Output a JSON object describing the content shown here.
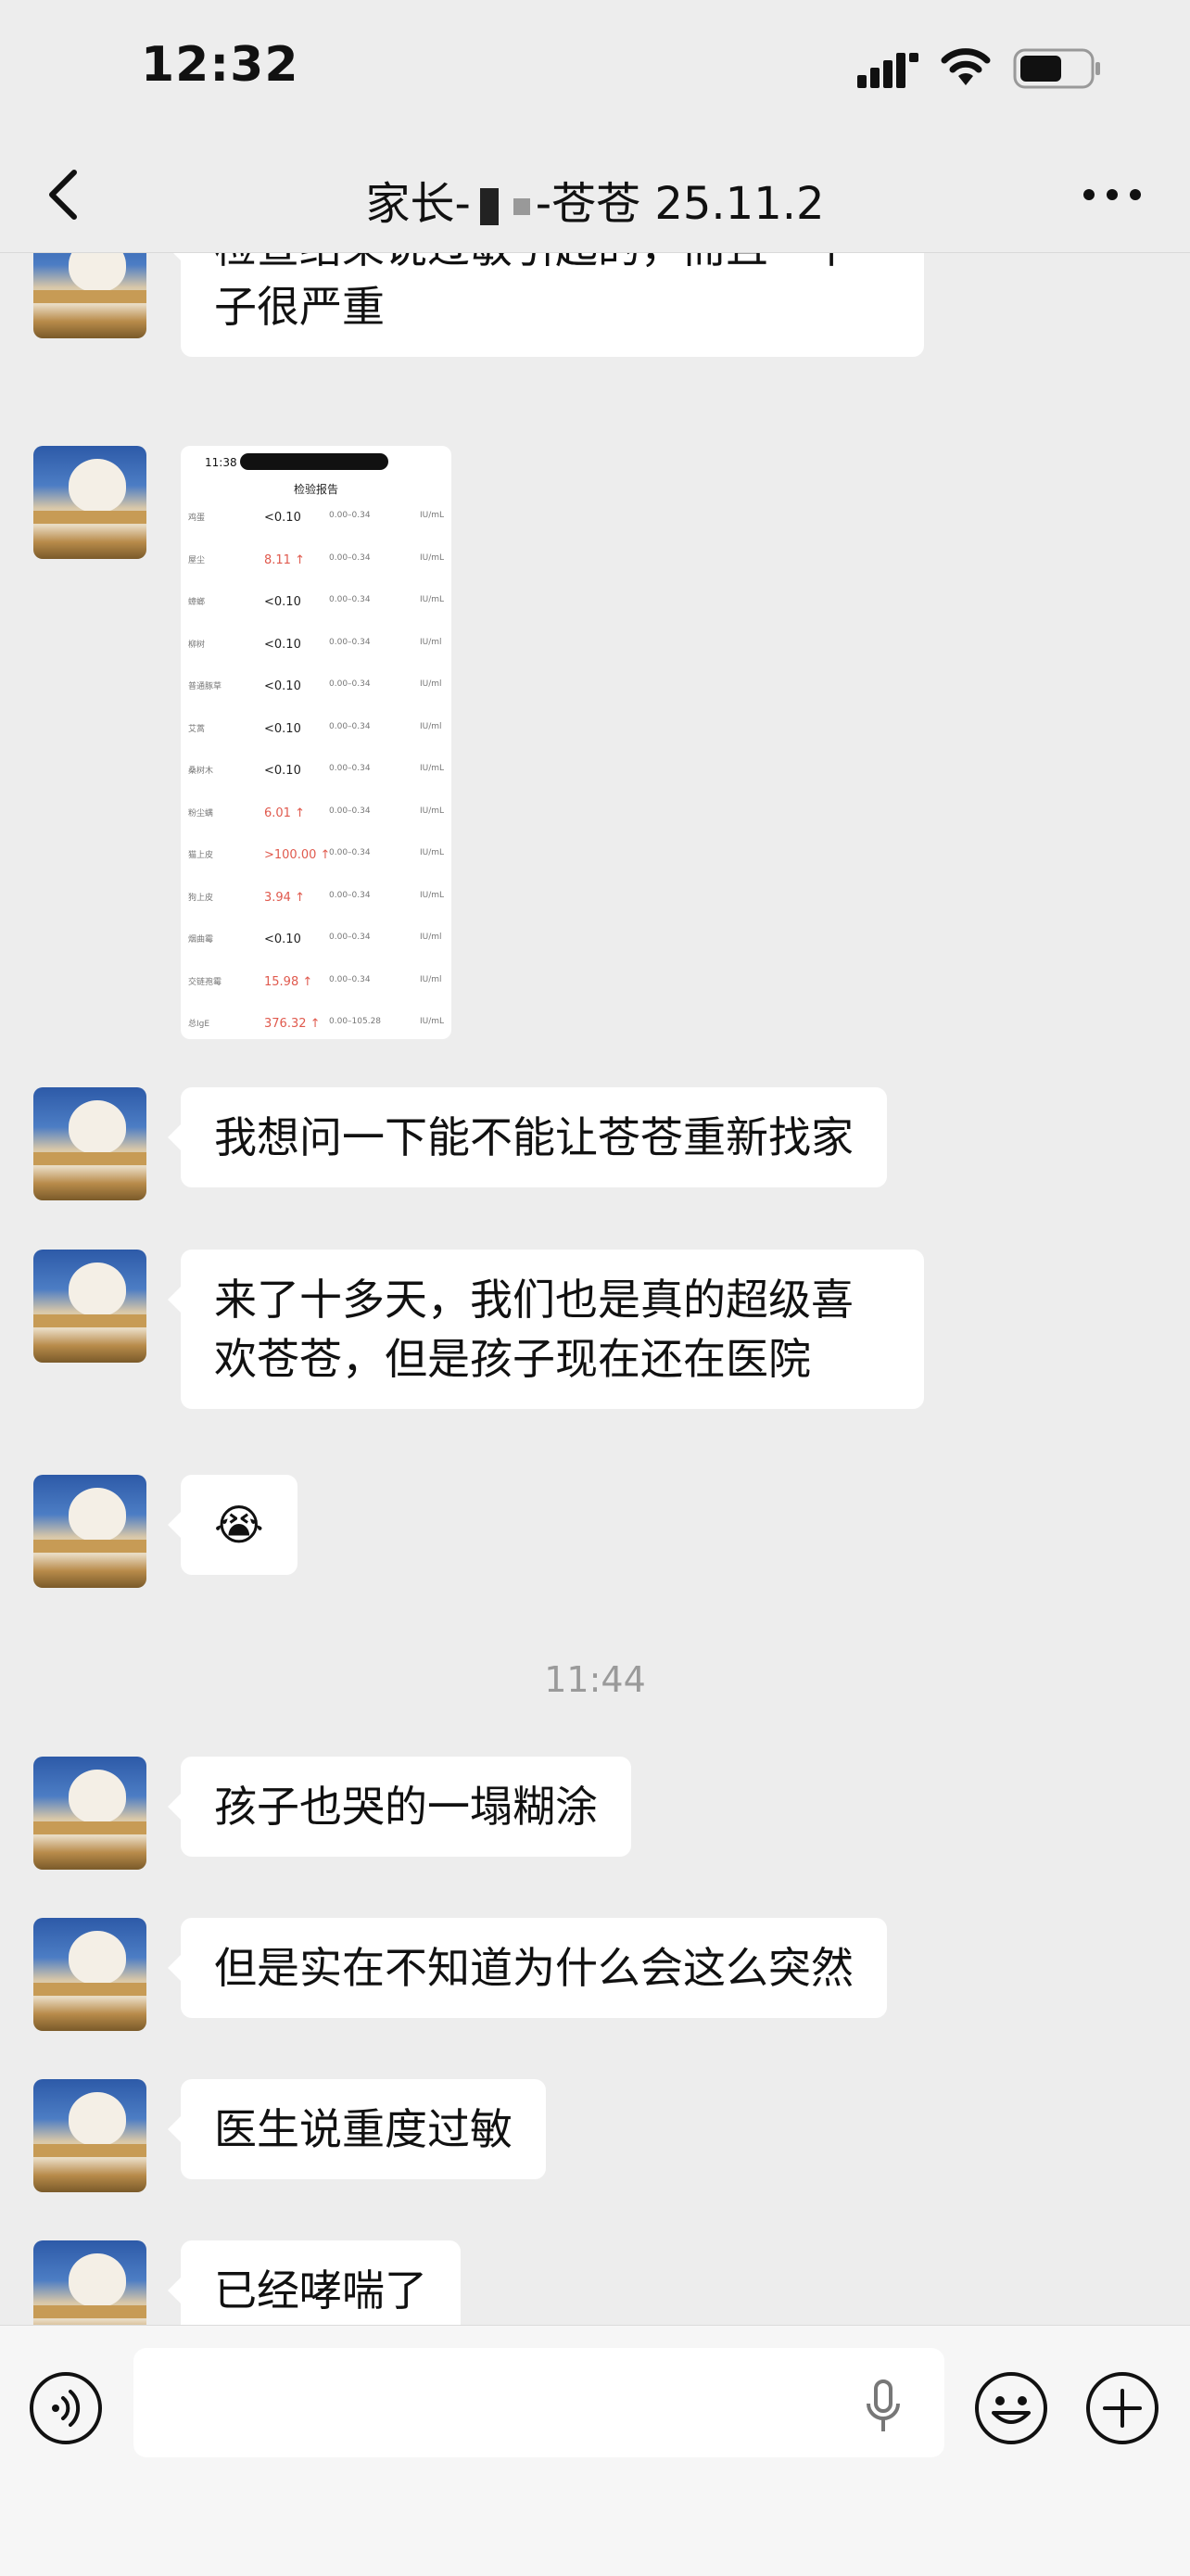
{
  "status_bar": {
    "time": "12:32"
  },
  "nav": {
    "title_prefix": "家长-",
    "title_suffix": "-苍苍 25.11.2"
  },
  "messages": [
    {
      "text": "检查结果说过敏引起的，而且一下子很严重"
    },
    {
      "text": "我想问一下能不能让苍苍重新找家"
    },
    {
      "text": "来了十多天，我们也是真的超级喜欢苍苍，但是孩子现在还在医院"
    },
    {
      "emoji": "😭"
    },
    {
      "text": "孩子也哭的一塌糊涂"
    },
    {
      "text": "但是实在不知道为什么会这么突然"
    },
    {
      "text": "医生说重度过敏"
    },
    {
      "text": "已经哮喘了"
    }
  ],
  "timestamp": "11:44",
  "screenshot": {
    "time": "11:38",
    "header": "检验报告",
    "rows": [
      {
        "name": "鸡蛋",
        "value": "<0.10",
        "range": "0.00–0.34",
        "unit": "IU/mL",
        "high": false
      },
      {
        "name": "屋尘",
        "value": "8.11 ↑",
        "range": "0.00–0.34",
        "unit": "IU/mL",
        "high": true
      },
      {
        "name": "蟑螂",
        "value": "<0.10",
        "range": "0.00–0.34",
        "unit": "IU/mL",
        "high": false
      },
      {
        "name": "柳树",
        "value": "<0.10",
        "range": "0.00–0.34",
        "unit": "IU/ml",
        "high": false
      },
      {
        "name": "普通豚草",
        "value": "<0.10",
        "range": "0.00–0.34",
        "unit": "IU/ml",
        "high": false
      },
      {
        "name": "艾蒿",
        "value": "<0.10",
        "range": "0.00–0.34",
        "unit": "IU/ml",
        "high": false
      },
      {
        "name": "桑树木",
        "value": "<0.10",
        "range": "0.00–0.34",
        "unit": "IU/mL",
        "high": false
      },
      {
        "name": "粉尘螨",
        "value": "6.01 ↑",
        "range": "0.00–0.34",
        "unit": "IU/mL",
        "high": true
      },
      {
        "name": "猫上皮",
        "value": ">100.00 ↑",
        "range": "0.00–0.34",
        "unit": "IU/mL",
        "high": true
      },
      {
        "name": "狗上皮",
        "value": "3.94 ↑",
        "range": "0.00–0.34",
        "unit": "IU/mL",
        "high": true
      },
      {
        "name": "烟曲霉",
        "value": "<0.10",
        "range": "0.00–0.34",
        "unit": "IU/ml",
        "high": false
      },
      {
        "name": "交链孢霉",
        "value": "15.98 ↑",
        "range": "0.00–0.34",
        "unit": "IU/ml",
        "high": true
      },
      {
        "name": "总IgE",
        "value": "376.32 ↑",
        "range": "0.00–105.28",
        "unit": "IU/mL",
        "high": true
      }
    ]
  },
  "colors": {
    "background": "#ededed",
    "bubble": "#ffffff",
    "high_value": "#e05a4e"
  }
}
